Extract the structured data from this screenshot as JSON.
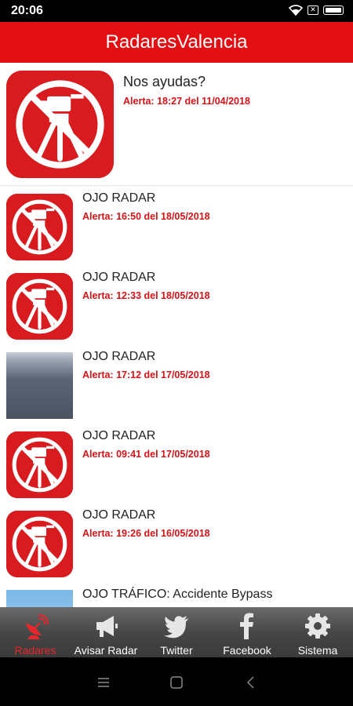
{
  "status_bar": {
    "time": "20:06",
    "icons": [
      "wifi-icon",
      "sim-x-icon",
      "battery-icon"
    ]
  },
  "app_bar": {
    "title": "RadaresValencia"
  },
  "colors": {
    "brand_red": "#e21013",
    "alert_red": "#d01417",
    "active_tab": "#e8262b"
  },
  "feed": {
    "items": [
      {
        "title": "Nos ayudas?",
        "alert": "Alerta: 18:27 del 11/04/2018",
        "thumb": "no-radar-icon"
      },
      {
        "title": "OJO RADAR",
        "alert": "Alerta: 16:50 del 18/05/2018",
        "thumb": "no-radar-icon"
      },
      {
        "title": "OJO RADAR",
        "alert": "Alerta: 12:33 del 18/05/2018",
        "thumb": "no-radar-icon"
      },
      {
        "title": "OJO RADAR",
        "alert": "Alerta: 17:12 del 17/05/2018",
        "thumb": "road-photo"
      },
      {
        "title": "OJO RADAR",
        "alert": "Alerta: 09:41 del 17/05/2018",
        "thumb": "no-radar-icon"
      },
      {
        "title": "OJO RADAR",
        "alert": "Alerta: 19:26 del 16/05/2018",
        "thumb": "no-radar-icon"
      },
      {
        "title": "OJO TRÁFICO: Accidente Bypass",
        "alert": "",
        "thumb": "sky-photo"
      }
    ]
  },
  "tab_bar": {
    "tabs": [
      {
        "label": "Radares",
        "icon": "radar-dish-icon",
        "active": true
      },
      {
        "label": "Avisar Radar",
        "icon": "megaphone-icon",
        "active": false
      },
      {
        "label": "Twitter",
        "icon": "twitter-bird-icon",
        "active": false
      },
      {
        "label": "Facebook",
        "icon": "facebook-f-icon",
        "active": false
      },
      {
        "label": "Sistema",
        "icon": "gear-icon",
        "active": false
      }
    ]
  },
  "nav_bar": {
    "buttons": [
      "menu-icon",
      "home-icon",
      "back-icon"
    ]
  }
}
